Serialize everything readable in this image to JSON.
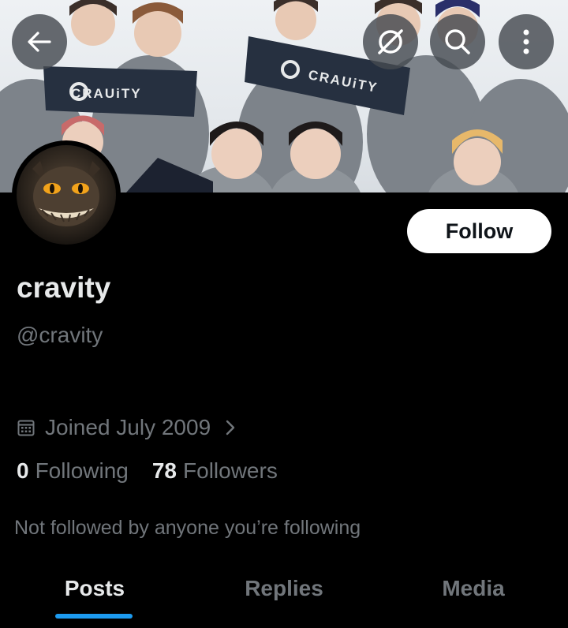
{
  "header": {
    "back_icon": "arrow-left-icon",
    "grok_icon": "grok-icon",
    "search_icon": "search-icon",
    "more_icon": "more-vertical-icon"
  },
  "banner": {
    "towel_left_text": "CRAUiTY",
    "towel_right_text": "CRAUiTY"
  },
  "profile": {
    "follow_label": "Follow",
    "display_name": "cravity",
    "handle": "@cravity",
    "joined": "Joined July 2009",
    "following_count": "0",
    "following_label": "Following",
    "followers_count": "78",
    "followers_label": "Followers",
    "not_followed_text": "Not followed by anyone you’re following"
  },
  "tabs": [
    {
      "label": "Posts",
      "active": true
    },
    {
      "label": "Replies",
      "active": false
    },
    {
      "label": "Media",
      "active": false
    }
  ],
  "colors": {
    "background": "#000000",
    "accent": "#1d9bf0",
    "secondary_text": "#71767b",
    "primary_text": "#e7e9ea"
  }
}
